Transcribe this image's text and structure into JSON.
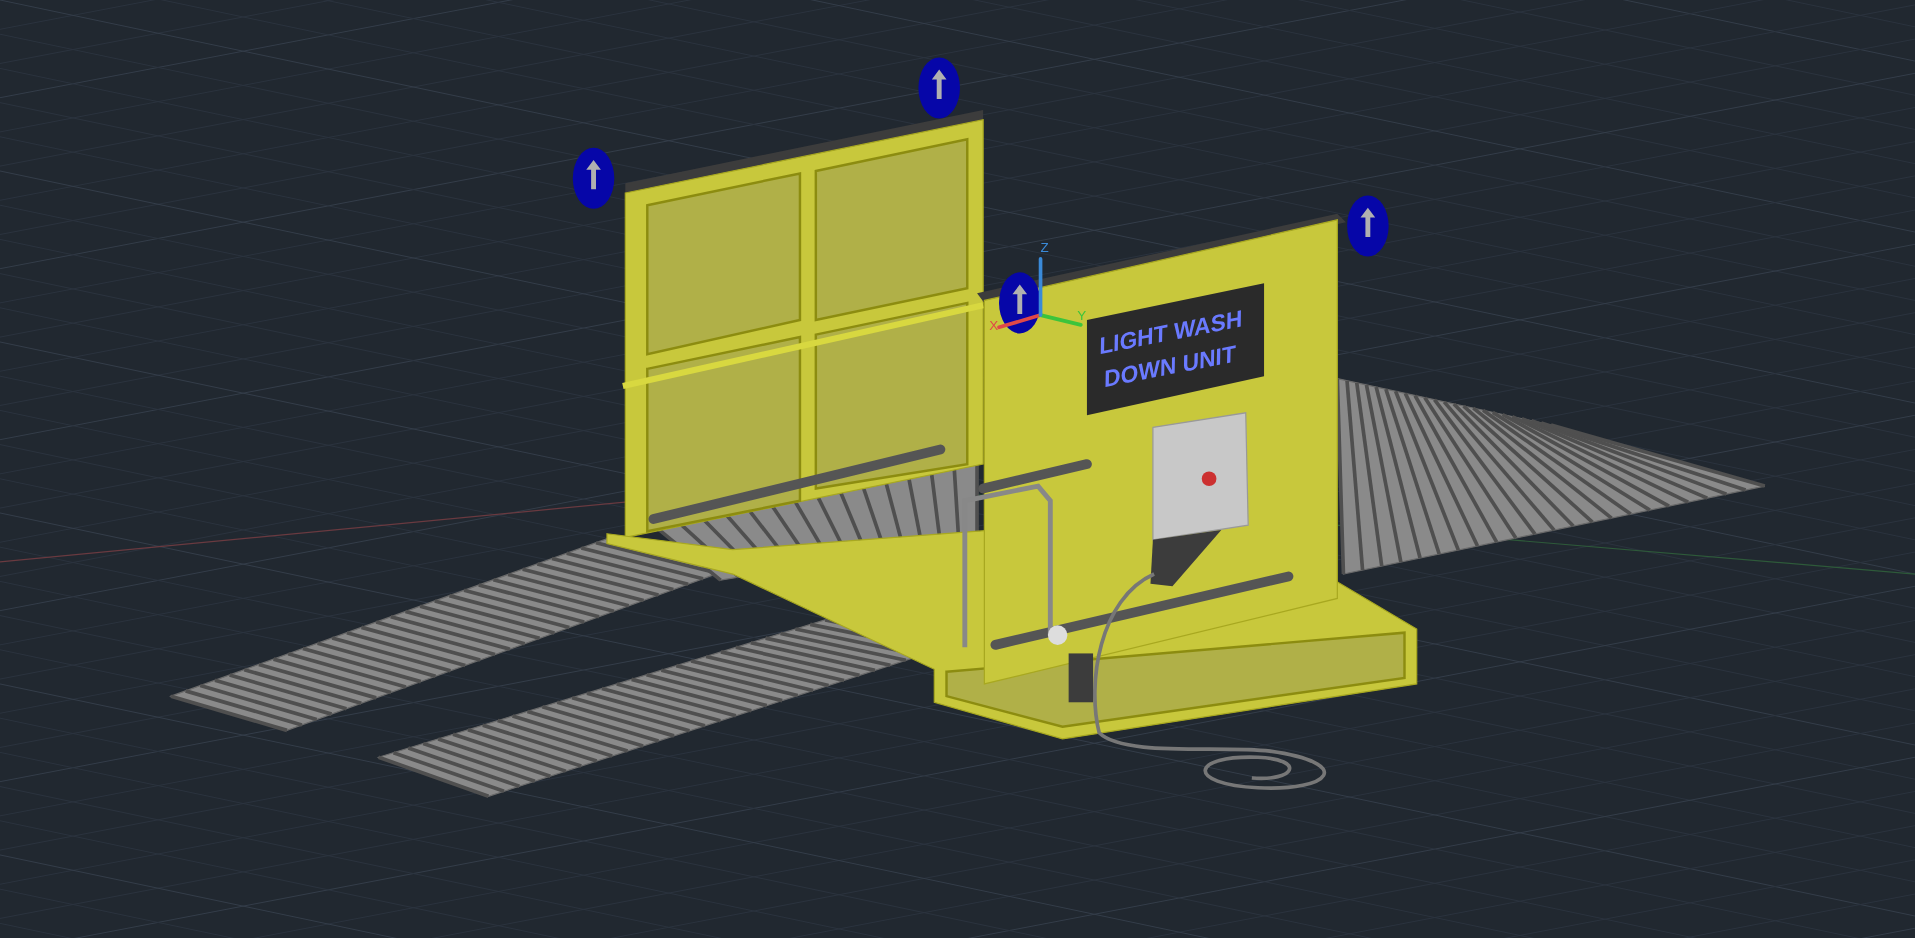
{
  "viewport": {
    "sign": {
      "lines": [
        "LIGHT WASH",
        "DOWN UNIT"
      ]
    },
    "ucs_icon": {
      "axes": [
        {
          "label": "X",
          "color": "#e04848"
        },
        {
          "label": "Y",
          "color": "#3cc43c"
        },
        {
          "label": "Z",
          "color": "#3a8ad8"
        }
      ]
    }
  }
}
